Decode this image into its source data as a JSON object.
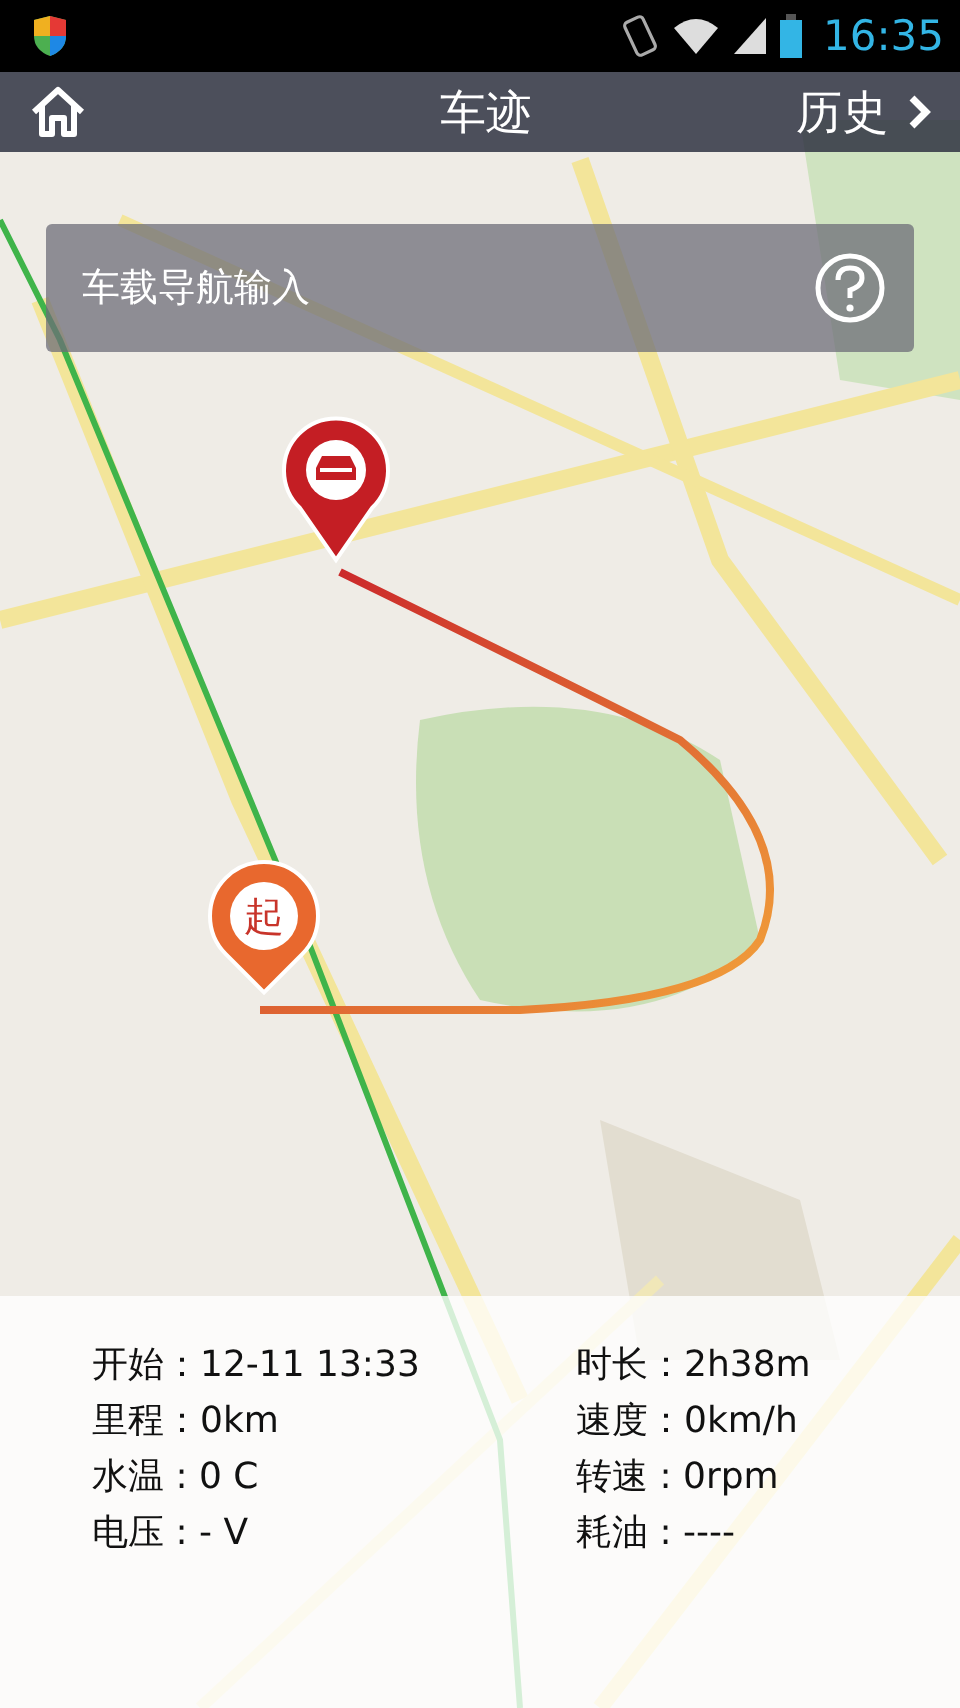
{
  "status_bar": {
    "time": "16:35"
  },
  "header": {
    "title": "车迹",
    "history": "历史"
  },
  "nav_input": {
    "label": "车载导航输入"
  },
  "map": {
    "start_marker": "起"
  },
  "trip_info": [
    {
      "text": "开始：12-11 13:33"
    },
    {
      "text": "时长：2h38m"
    },
    {
      "text": "里程：0km"
    },
    {
      "text": "速度：0km/h"
    },
    {
      "text": "水温 : 0 C"
    },
    {
      "text": "转速 : 0rpm"
    },
    {
      "text": "电压 : - V"
    },
    {
      "text": "耗油 : ----"
    }
  ]
}
